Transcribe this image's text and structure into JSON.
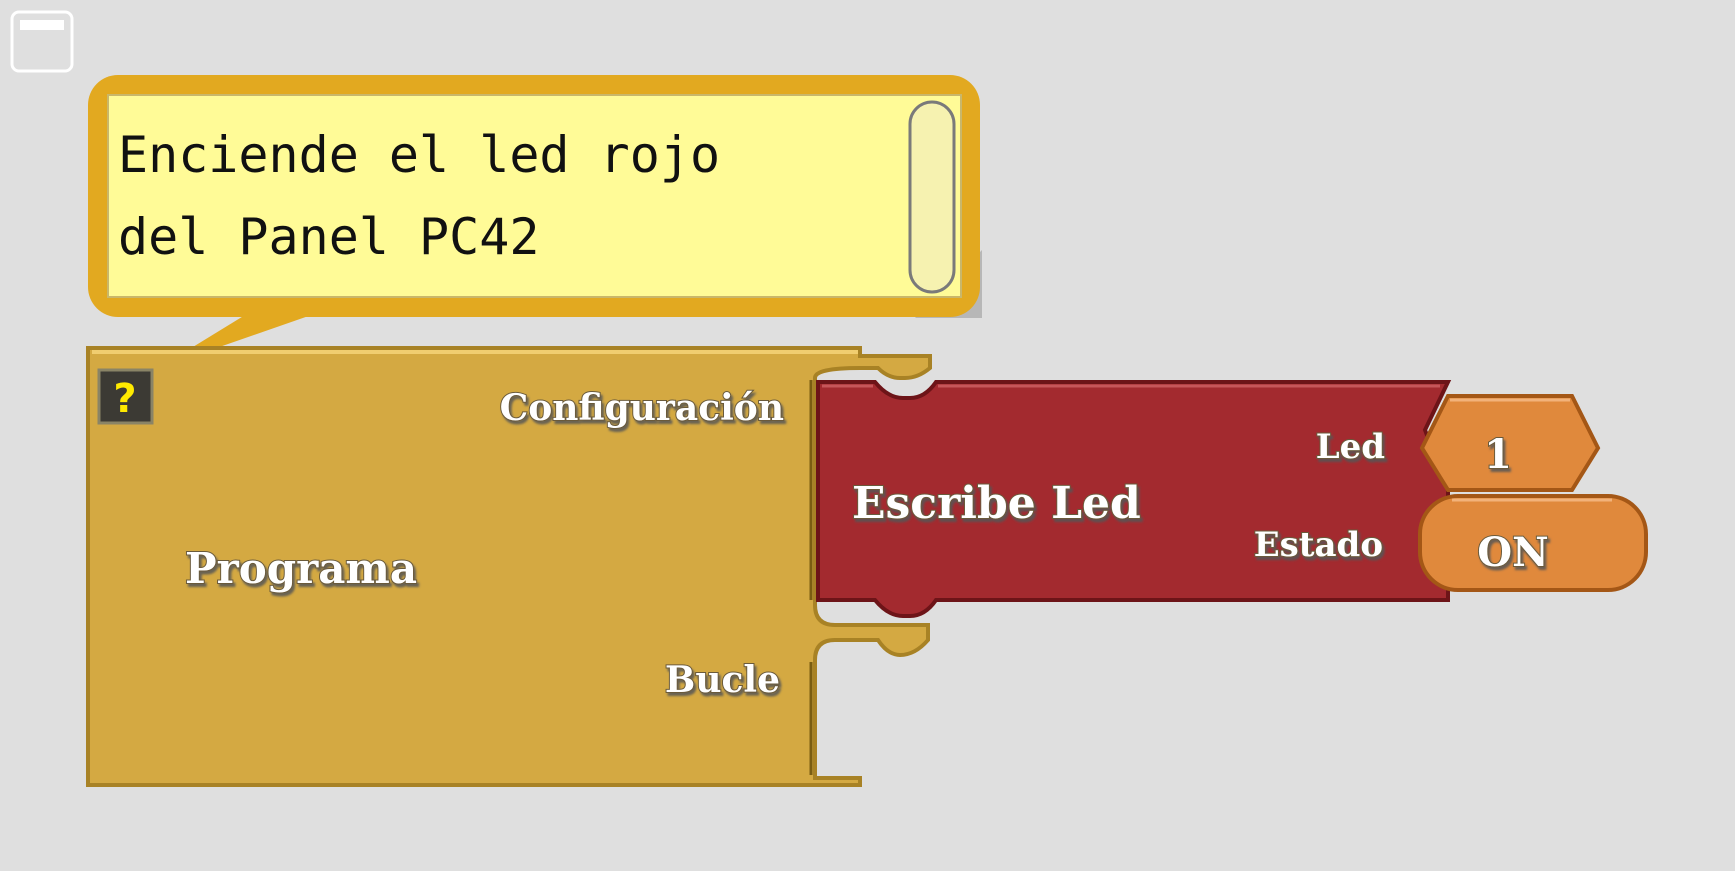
{
  "workspace": {
    "background_color": "#dfdfdf",
    "minimize_icon": "window-minimize-icon"
  },
  "comment": {
    "text": "Enciende el led rojo\ndel Panel PC42",
    "frame_color": "#e2a920",
    "fill_color": "#fffb97"
  },
  "program_block": {
    "title": "Programa",
    "config_label": "Configuración",
    "loop_label": "Bucle",
    "help_symbol": "?",
    "color": "#d4a942",
    "help_icon": "question-mark-icon"
  },
  "write_led_block": {
    "title": "Escribe Led",
    "led_label": "Led",
    "state_label": "Estado",
    "color": "#a32a2f"
  },
  "led_value_block": {
    "value": "1",
    "color": "#e0893c"
  },
  "state_value_block": {
    "value": "ON",
    "color": "#e0893c"
  }
}
